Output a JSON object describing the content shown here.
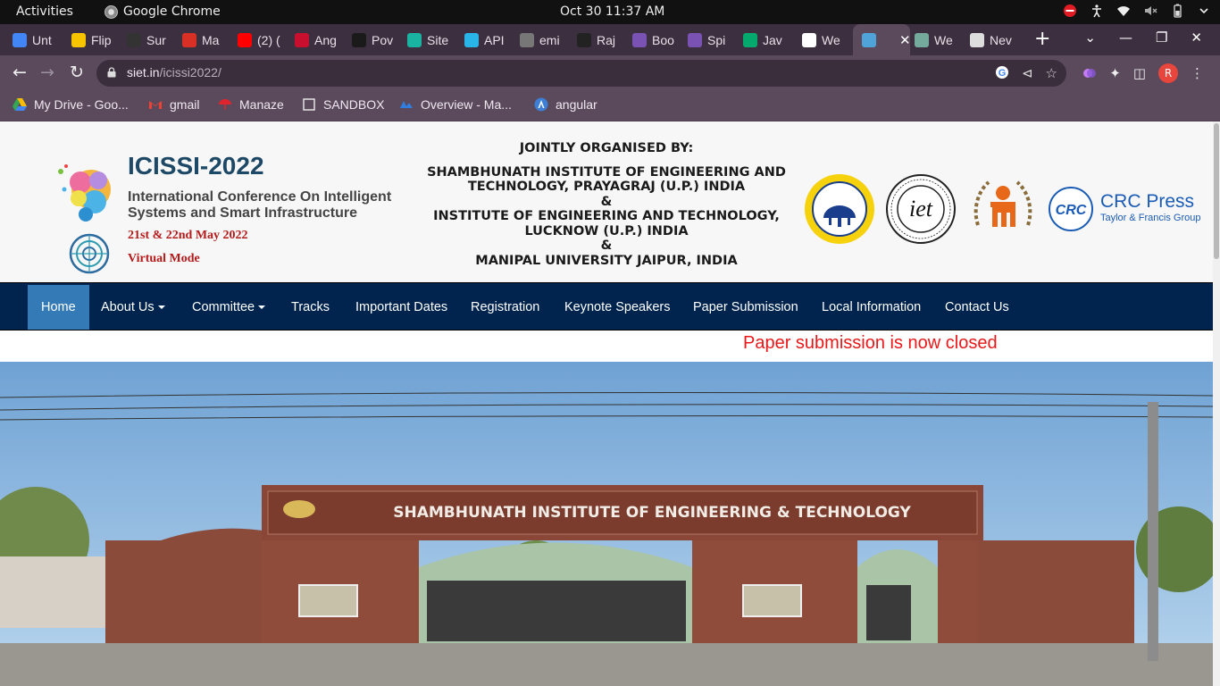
{
  "system": {
    "activities": "Activities",
    "app_name": "Google Chrome",
    "clock": "Oct 30  11:37 AM"
  },
  "tabs": [
    {
      "label": "Unt",
      "icon": "google-docs-icon",
      "color": "#4285f4"
    },
    {
      "label": "Flip",
      "icon": "flipkart-icon",
      "color": "#f8c400"
    },
    {
      "label": "Sur",
      "icon": "survey-icon",
      "color": "#333333"
    },
    {
      "label": "Ma",
      "icon": "manaze-umbrella-icon",
      "color": "#d93025"
    },
    {
      "label": "(2) (",
      "icon": "youtube-icon",
      "color": "#ff0000"
    },
    {
      "label": "Ang",
      "icon": "b-icon",
      "color": "#c8102e"
    },
    {
      "label": "Pov",
      "icon": "terminal-icon",
      "color": "#1a1a1a"
    },
    {
      "label": "Site",
      "icon": "diamond-icon",
      "color": "#1ab2a0"
    },
    {
      "label": "API",
      "icon": "snowflake-icon",
      "color": "#29b5e8"
    },
    {
      "label": "emi",
      "icon": "emi-icon",
      "color": "#777777"
    },
    {
      "label": "Raj",
      "icon": "a-icon",
      "color": "#222222"
    },
    {
      "label": "Boo",
      "icon": "bootstrap-icon",
      "color": "#7952b3"
    },
    {
      "label": "Spi",
      "icon": "bootstrap-icon",
      "color": "#7952b3"
    },
    {
      "label": "Jav",
      "icon": "w-icon",
      "color": "#04aa6d"
    },
    {
      "label": "We",
      "icon": "github-icon",
      "color": "#ffffff"
    },
    {
      "label": "",
      "icon": "site-favicon",
      "color": "#4fa3d9",
      "active": true
    },
    {
      "label": "We",
      "icon": "openai-icon",
      "color": "#74aa9c"
    },
    {
      "label": "Nev",
      "icon": "chrome-icon",
      "color": "#dddddd"
    }
  ],
  "address_bar": {
    "host": "siet.in",
    "path": "/icissi2022/"
  },
  "bookmarks": [
    {
      "label": "My Drive - Goo...",
      "icon": "google-drive-icon"
    },
    {
      "label": "gmail",
      "icon": "gmail-icon"
    },
    {
      "label": "Manaze",
      "icon": "manaze-umbrella-icon"
    },
    {
      "label": "SANDBOX",
      "icon": "checkbox-icon"
    },
    {
      "label": "Overview - Ma...",
      "icon": "overview-icon"
    },
    {
      "label": "angular",
      "icon": "angular-icon"
    }
  ],
  "header": {
    "title": "ICISSI-2022",
    "subtitle": "International Conference On Intelligent Systems and Smart Infrastructure",
    "dates": "21st & 22nd May 2022",
    "mode": "Virtual Mode",
    "organised_by": "JOINTLY ORGANISED BY:",
    "org1": "SHAMBHUNATH INSTITUTE OF ENGINEERING AND TECHNOLOGY, PRAYAGRAJ (U.P.) INDIA",
    "amp1": "&",
    "org2": "INSTITUTE OF ENGINEERING AND TECHNOLOGY, LUCKNOW (U.P.) INDIA",
    "amp2": "&",
    "org3": "MANIPAL UNIVERSITY JAIPUR, INDIA",
    "crc_name": "CRC Press",
    "crc_group": "Taylor & Francis Group",
    "crc_badge": "CRC"
  },
  "nav": {
    "items": [
      {
        "label": "Home",
        "active": true
      },
      {
        "label": "About Us",
        "dropdown": true
      },
      {
        "label": "Committee",
        "dropdown": true
      },
      {
        "label": "Tracks"
      },
      {
        "label": "Important Dates"
      },
      {
        "label": "Registration"
      },
      {
        "label": "Keynote Speakers"
      },
      {
        "label": "Paper Submission"
      },
      {
        "label": "Local Information"
      },
      {
        "label": "Contact Us"
      }
    ]
  },
  "notice": "Paper submission is now closed",
  "banner": {
    "gate_sign": "SHAMBHUNATH  INSTITUTE OF ENGINEERING & TECHNOLOGY"
  },
  "colors": {
    "nav_bg": "#01244f",
    "nav_active": "#337ab7",
    "notice_red": "#e8181a",
    "title_blue": "#1d4966",
    "date_red": "#b51a1a"
  }
}
